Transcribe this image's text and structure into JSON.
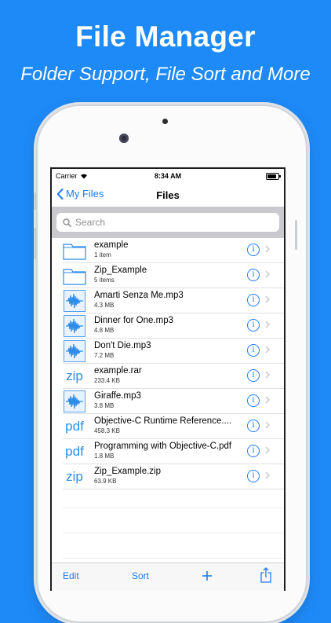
{
  "promo": {
    "title": "File Manager",
    "subtitle": "Folder Support, File Sort and More"
  },
  "status": {
    "carrier": "Carrier",
    "time": "8:34 AM"
  },
  "nav": {
    "back_label": "My Files",
    "title": "Files"
  },
  "search": {
    "placeholder": "Search"
  },
  "files": [
    {
      "name": "example",
      "detail": "1 item",
      "icon": "folder-icon"
    },
    {
      "name": "Zip_Example",
      "detail": "5 items",
      "icon": "folder-icon"
    },
    {
      "name": "Amarti Senza Me.mp3",
      "detail": "4.3 MB",
      "icon": "audio-file-icon"
    },
    {
      "name": "Dinner for One.mp3",
      "detail": "4.8 MB",
      "icon": "audio-file-icon"
    },
    {
      "name": "Don't Die.mp3",
      "detail": "7.2 MB",
      "icon": "audio-file-icon"
    },
    {
      "name": "example.rar",
      "detail": "233.4 KB",
      "icon": "zip-file-icon",
      "ext": "zip"
    },
    {
      "name": "Giraffe.mp3",
      "detail": "3.8 MB",
      "icon": "audio-file-icon"
    },
    {
      "name": "Objective-C Runtime Reference....",
      "detail": "458.3 KB",
      "icon": "pdf-file-icon",
      "ext": "pdf"
    },
    {
      "name": "Programming with Objective-C.pdf",
      "detail": "1.8 MB",
      "icon": "pdf-file-icon",
      "ext": "pdf"
    },
    {
      "name": "Zip_Example.zip",
      "detail": "63.9 KB",
      "icon": "zip-file-icon",
      "ext": "zip"
    }
  ],
  "toolbar": {
    "edit_label": "Edit",
    "sort_label": "Sort",
    "add_icon": "plus-icon",
    "share_icon": "share-icon"
  },
  "colors": {
    "background": "#1E8AF7",
    "accent": "#1E7CF2",
    "search_bar": "#C9C9CE"
  }
}
